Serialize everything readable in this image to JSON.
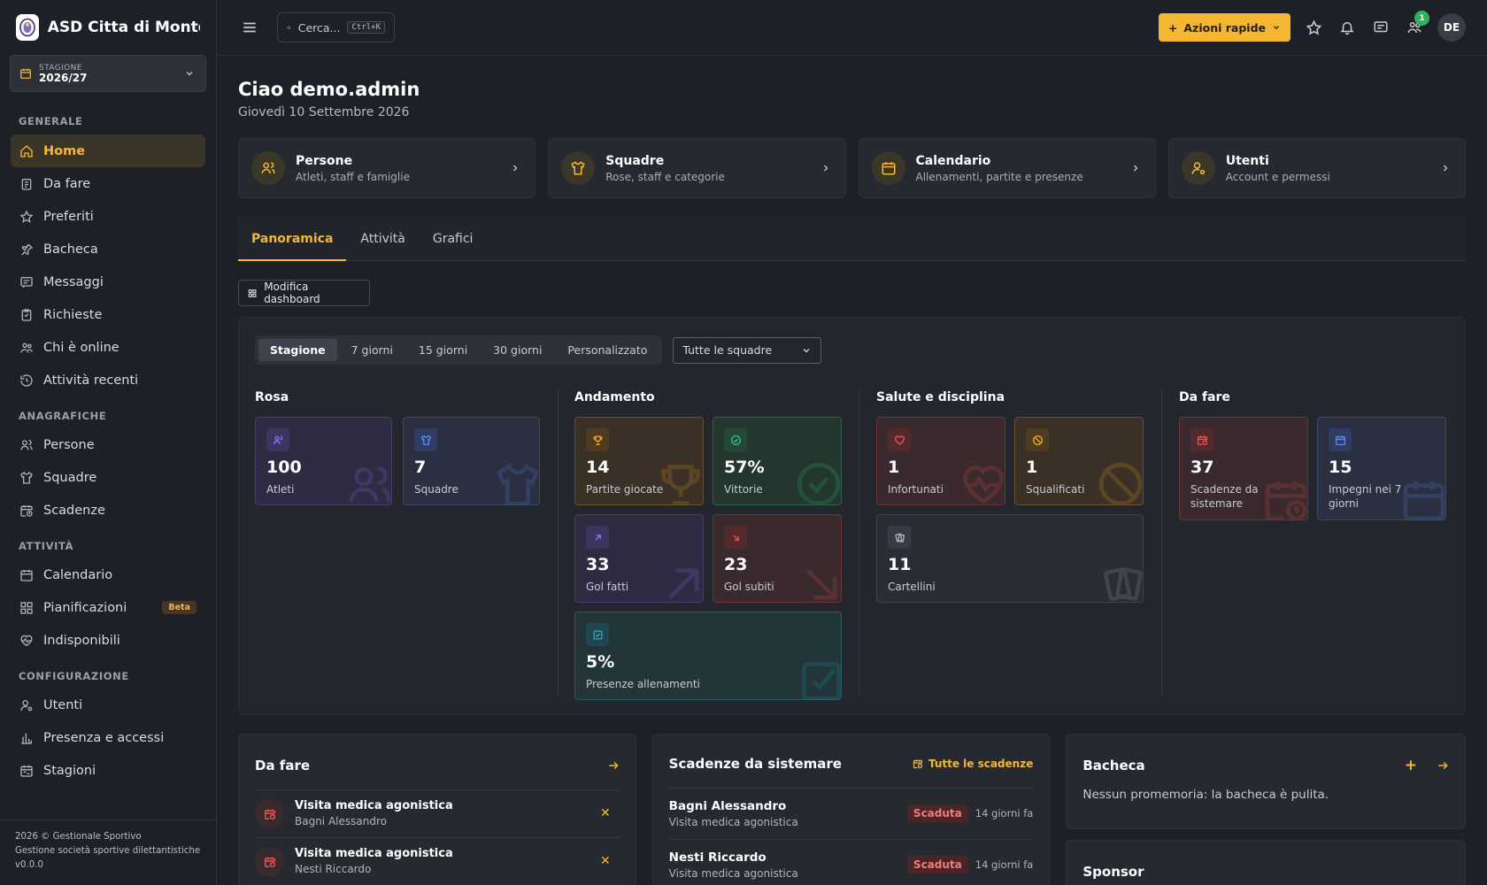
{
  "brand": {
    "title": "ASD Citta di Monto..."
  },
  "season": {
    "label": "STAGIONE",
    "value": "2026/27"
  },
  "sidebar": {
    "sections": [
      {
        "title": "GENERALE",
        "items": [
          {
            "label": "Home",
            "icon": "home-icon",
            "active": true
          },
          {
            "label": "Da fare",
            "icon": "clipboard-icon"
          },
          {
            "label": "Preferiti",
            "icon": "star-icon"
          },
          {
            "label": "Bacheca",
            "icon": "pin-icon"
          },
          {
            "label": "Messaggi",
            "icon": "message-icon"
          },
          {
            "label": "Richieste",
            "icon": "request-icon"
          },
          {
            "label": "Chi è online",
            "icon": "users-online-icon"
          },
          {
            "label": "Attività recenti",
            "icon": "history-icon"
          }
        ]
      },
      {
        "title": "ANAGRAFICHE",
        "items": [
          {
            "label": "Persone",
            "icon": "users-icon"
          },
          {
            "label": "Squadre",
            "icon": "shirt-icon"
          },
          {
            "label": "Scadenze",
            "icon": "calendar-clock-icon"
          }
        ]
      },
      {
        "title": "ATTIVITÀ",
        "items": [
          {
            "label": "Calendario",
            "icon": "calendar-icon"
          },
          {
            "label": "Pianificazioni",
            "icon": "grid-icon",
            "badge": "Beta"
          },
          {
            "label": "Indisponibili",
            "icon": "heart-pulse-icon"
          }
        ]
      },
      {
        "title": "CONFIGURAZIONE",
        "items": [
          {
            "label": "Utenti",
            "icon": "user-cog-icon"
          },
          {
            "label": "Presenza e accessi",
            "icon": "bar-chart-icon"
          },
          {
            "label": "Stagioni",
            "icon": "calendar-range-icon"
          }
        ]
      }
    ],
    "footer": {
      "line1": "2026 © Gestionale Sportivo",
      "line2": "Gestione società sportive dilettantistiche",
      "line3": "v0.0.0"
    }
  },
  "topbar": {
    "search_placeholder": "Cerca...",
    "search_shortcut": "Ctrl+K",
    "quick_actions": "Azioni rapide",
    "notifications_count": "1",
    "avatar": "DE"
  },
  "header": {
    "greeting": "Ciao demo.admin",
    "date": "Giovedì 10 Settembre 2026"
  },
  "quick_cards": [
    {
      "title": "Persone",
      "subtitle": "Atleti, staff e famiglie",
      "icon": "users-icon"
    },
    {
      "title": "Squadre",
      "subtitle": "Rose, staff e categorie",
      "icon": "shirt-icon"
    },
    {
      "title": "Calendario",
      "subtitle": "Allenamenti, partite e presenze",
      "icon": "calendar-icon"
    },
    {
      "title": "Utenti",
      "subtitle": "Account e permessi",
      "icon": "user-cog-icon"
    }
  ],
  "tabs": [
    "Panoramica",
    "Attività",
    "Grafici"
  ],
  "edit_dashboard": "Modifica dashboard",
  "filters": {
    "periods": [
      "Stagione",
      "7 giorni",
      "15 giorni",
      "30 giorni",
      "Personalizzato"
    ],
    "active_period": "Stagione",
    "team_select": "Tutte le squadre"
  },
  "stats": {
    "rosa": {
      "title": "Rosa",
      "items": [
        {
          "value": "100",
          "label": "Atleti"
        },
        {
          "value": "7",
          "label": "Squadre"
        }
      ]
    },
    "andamento": {
      "title": "Andamento",
      "items": [
        {
          "value": "14",
          "label": "Partite giocate"
        },
        {
          "value": "57%",
          "label": "Vittorie"
        },
        {
          "value": "33",
          "label": "Gol fatti"
        },
        {
          "value": "23",
          "label": "Gol subiti"
        },
        {
          "value": "5%",
          "label": "Presenze allenamenti"
        }
      ]
    },
    "salute": {
      "title": "Salute e disciplina",
      "items": [
        {
          "value": "1",
          "label": "Infortunati"
        },
        {
          "value": "1",
          "label": "Squalificati"
        },
        {
          "value": "11",
          "label": "Cartellini"
        }
      ]
    },
    "dafare": {
      "title": "Da fare",
      "items": [
        {
          "value": "37",
          "label": "Scadenze da sistemare"
        },
        {
          "value": "15",
          "label": "Impegni nei 7 giorni"
        }
      ]
    }
  },
  "colors": {
    "accent": "#f5b731",
    "purple": "#7b5cf0",
    "blue": "#4a7ae0",
    "green": "#34c27a",
    "red": "#ef5350",
    "orange": "#f5a623",
    "teal": "#22a7c4"
  },
  "bottom": {
    "todo": {
      "title": "Da fare",
      "items": [
        {
          "title": "Visita medica agonistica",
          "sub": "Bagni Alessandro"
        },
        {
          "title": "Visita medica agonistica",
          "sub": "Nesti Riccardo"
        }
      ]
    },
    "deadlines": {
      "title": "Scadenze da sistemare",
      "link": "Tutte le scadenze",
      "items": [
        {
          "name": "Bagni Alessandro",
          "sub": "Visita medica agonistica",
          "status": "Scaduta",
          "ago": "14 giorni fa"
        },
        {
          "name": "Nesti Riccardo",
          "sub": "Visita medica agonistica",
          "status": "Scaduta",
          "ago": "14 giorni fa"
        }
      ]
    },
    "board": {
      "title": "Bacheca",
      "empty": "Nessun promemoria: la bacheca è pulita."
    },
    "sponsor": {
      "title": "Sponsor"
    }
  }
}
